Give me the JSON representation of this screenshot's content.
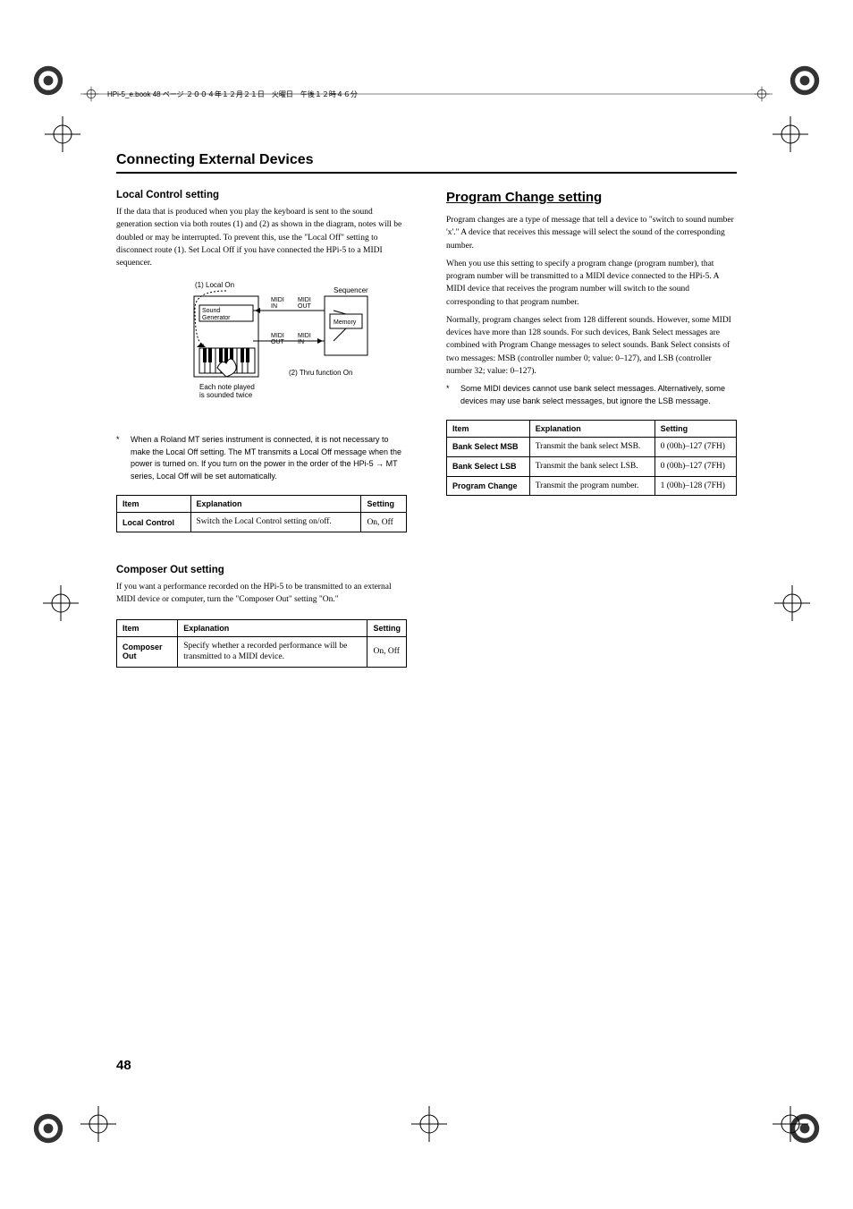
{
  "header_text": "HPi-5_e.book 48 ページ ２００４年１２月２１日　火曜日　午後１２時４６分",
  "section_title": "Connecting External Devices",
  "left": {
    "local_control": {
      "heading": "Local Control setting",
      "para": "If the data that is produced when you play the keyboard is sent to the sound generation section via both routes (1) and (2) as shown in the diagram, notes will be doubled or may be interrupted. To prevent this, use the \"Local Off\" setting to disconnect route (1). Set Local Off if you have connected the HPi-5 to a MIDI sequencer.",
      "diagram": {
        "label_local_on": "(1)  Local On",
        "label_sound_gen": "Sound Generator",
        "label_midi_in": "MIDI IN",
        "label_midi_out": "MIDI OUT",
        "label_sequencer": "Sequencer",
        "label_memory": "Memory",
        "label_thru": "(2)  Thru function On",
        "label_each_note": "Each note played is sounded twice"
      },
      "footnote": "When a Roland MT series instrument is connected, it is not necessary to make the Local Off setting. The MT transmits a Local Off message when the power is turned on. If you turn on the power in the order of the HPi-5 → MT series, Local Off will be set automatically.",
      "table": {
        "headers": [
          "Item",
          "Explanation",
          "Setting"
        ],
        "row": {
          "item": "Local Control",
          "explanation": "Switch the Local Control setting on/off.",
          "setting": "On, Off"
        }
      }
    },
    "composer_out": {
      "heading": "Composer Out setting",
      "para": "If you want a performance recorded on the HPi-5 to be transmitted to an external MIDI device or computer, turn the \"Composer Out\" setting \"On.\"",
      "table": {
        "headers": [
          "Item",
          "Explanation",
          "Setting"
        ],
        "row": {
          "item": "Composer Out",
          "explanation": "Specify whether a recorded performance will be transmitted to a MIDI device.",
          "setting": "On, Off"
        }
      }
    }
  },
  "right": {
    "heading": "Program Change setting",
    "para1": "Program changes are a type of message that tell a device to \"switch to sound number 'x'.\" A device that receives this message will select the sound of the corresponding number.",
    "para2": "When you use this setting to specify a program change (program number), that program number will be transmitted to a MIDI device connected to the HPi-5. A MIDI device that receives the program number will switch to the sound corresponding to that program number.",
    "para3": "Normally, program changes select from 128 different sounds. However, some MIDI devices have more than 128 sounds. For such devices, Bank Select messages are combined with Program Change messages to select sounds. Bank Select consists of two messages: MSB (controller number 0; value: 0–127), and LSB (controller number 32; value: 0–127).",
    "footnote": "Some MIDI devices cannot use bank select messages. Alternatively, some devices may use bank select messages, but ignore the LSB message.",
    "table": {
      "headers": [
        "Item",
        "Explanation",
        "Setting"
      ],
      "rows": [
        {
          "item": "Bank Select MSB",
          "explanation": "Transmit the bank select MSB.",
          "setting": "0 (00h)–127 (7FH)"
        },
        {
          "item": "Bank Select LSB",
          "explanation": "Transmit the bank select LSB.",
          "setting": "0 (00h)–127 (7FH)"
        },
        {
          "item": "Program Change",
          "explanation": "Transmit the program number.",
          "setting": "1 (00h)–128 (7FH)"
        }
      ]
    }
  },
  "page_number": "48",
  "chart_data": {
    "type": "table",
    "tables": [
      {
        "title": "Local Control",
        "columns": [
          "Item",
          "Explanation",
          "Setting"
        ],
        "rows": [
          [
            "Local Control",
            "Switch the Local Control setting on/off.",
            "On, Off"
          ]
        ]
      },
      {
        "title": "Composer Out",
        "columns": [
          "Item",
          "Explanation",
          "Setting"
        ],
        "rows": [
          [
            "Composer Out",
            "Specify whether a recorded performance will be transmitted to a MIDI device.",
            "On, Off"
          ]
        ]
      },
      {
        "title": "Program Change",
        "columns": [
          "Item",
          "Explanation",
          "Setting"
        ],
        "rows": [
          [
            "Bank Select MSB",
            "Transmit the bank select MSB.",
            "0 (00h)–127 (7FH)"
          ],
          [
            "Bank Select LSB",
            "Transmit the bank select LSB.",
            "0 (00h)–127 (7FH)"
          ],
          [
            "Program Change",
            "Transmit the program number.",
            "1 (00h)–128 (7FH)"
          ]
        ]
      }
    ]
  }
}
